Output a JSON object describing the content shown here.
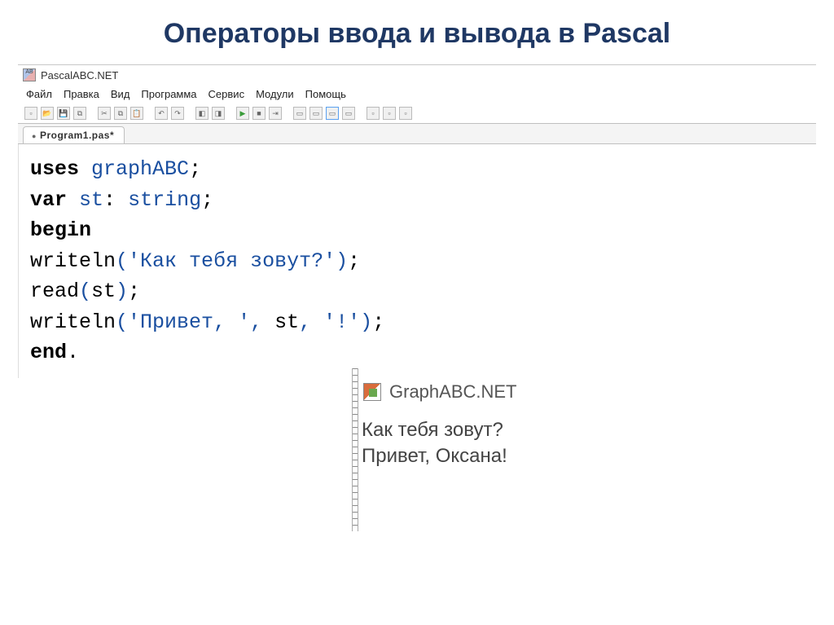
{
  "slide": {
    "title": "Операторы ввода и вывода в Pascal"
  },
  "ide": {
    "app_title": "PascalABC.NET",
    "menu": [
      "Файл",
      "Правка",
      "Вид",
      "Программа",
      "Сервис",
      "Модули",
      "Помощь"
    ],
    "tab": "Program1.pas*",
    "code": {
      "line1": {
        "kw": "uses",
        "id": "graphABC",
        "end": ";"
      },
      "line2": {
        "kw": "var",
        "id1": "st",
        "sep": ":",
        "id2": "string",
        "end": ";"
      },
      "line3": {
        "kw": "begin"
      },
      "line4": {
        "fn": "writeln",
        "open": "(",
        "str": "'Как тебя зовут?'",
        "close": ")",
        "end": ";"
      },
      "line5": {
        "fn": "read",
        "open": "(",
        "arg": "st",
        "close": ")",
        "end": ";"
      },
      "line6": {
        "fn": "writeln",
        "open": "(",
        "str1": "'Привет, '",
        "c1": ",",
        "arg": "st",
        "c2": ",",
        "str2": "'!'",
        "close": ")",
        "end": ";"
      },
      "line7": {
        "kw": "end",
        "dot": "."
      }
    }
  },
  "output": {
    "title": "GraphABC.NET",
    "line1": "Как тебя зовут?",
    "line2": "Привет, Оксана!"
  }
}
